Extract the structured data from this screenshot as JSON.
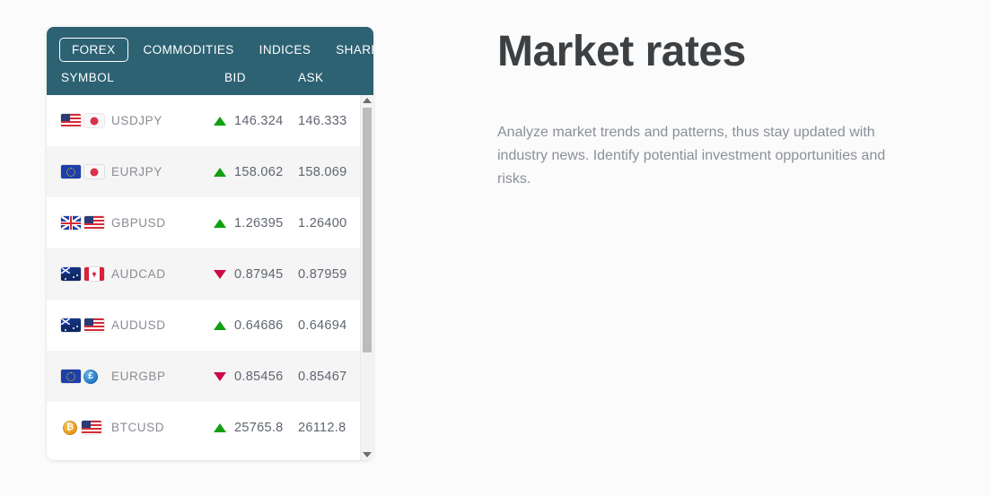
{
  "colors": {
    "header_teal": "#2d6273",
    "page_background": "#fbfbfb",
    "row_white": "#ffffff",
    "row_alt": "#f5f5f5",
    "up_green": "#10a010",
    "down_red": "#cc0b45",
    "symbol_text": "#8b8b94",
    "value_text": "#5f6570",
    "title_text": "#3c4043",
    "desc_text": "#8b9097"
  },
  "widget": {
    "tabs": [
      {
        "label": "FOREX",
        "active": true
      },
      {
        "label": "COMMODITIES",
        "active": false
      },
      {
        "label": "INDICES",
        "active": false
      },
      {
        "label": "SHARES",
        "active": false
      }
    ],
    "columns": {
      "symbol": "SYMBOL",
      "bid": "BID",
      "ask": "ASK"
    },
    "rows": [
      {
        "symbol": "USDJPY",
        "bid": "146.324",
        "ask": "146.333",
        "direction": "up",
        "icons": [
          "flag-us",
          "flag-jp"
        ]
      },
      {
        "symbol": "EURJPY",
        "bid": "158.062",
        "ask": "158.069",
        "direction": "up",
        "icons": [
          "flag-eu",
          "flag-jp"
        ]
      },
      {
        "symbol": "GBPUSD",
        "bid": "1.26395",
        "ask": "1.26400",
        "direction": "up",
        "icons": [
          "flag-gb",
          "flag-us"
        ]
      },
      {
        "symbol": "AUDCAD",
        "bid": "0.87945",
        "ask": "0.87959",
        "direction": "down",
        "icons": [
          "flag-au",
          "flag-ca"
        ]
      },
      {
        "symbol": "AUDUSD",
        "bid": "0.64686",
        "ask": "0.64694",
        "direction": "up",
        "icons": [
          "flag-au",
          "flag-us"
        ]
      },
      {
        "symbol": "EURGBP",
        "bid": "0.85456",
        "ask": "0.85467",
        "direction": "down",
        "icons": [
          "flag-eu",
          "coin-gbp"
        ]
      },
      {
        "symbol": "BTCUSD",
        "bid": "25765.8",
        "ask": "26112.8",
        "direction": "up",
        "icons": [
          "coin-btc",
          "flag-us"
        ]
      }
    ],
    "scrollbar": {
      "up_arrow": "scroll-up-icon",
      "down_arrow": "scroll-down-icon",
      "thumb_fraction": "72%"
    }
  },
  "content": {
    "title": "Market rates",
    "description": "Analyze market trends and patterns, thus stay updated with industry news. Identify potential investment opportunities and risks."
  }
}
